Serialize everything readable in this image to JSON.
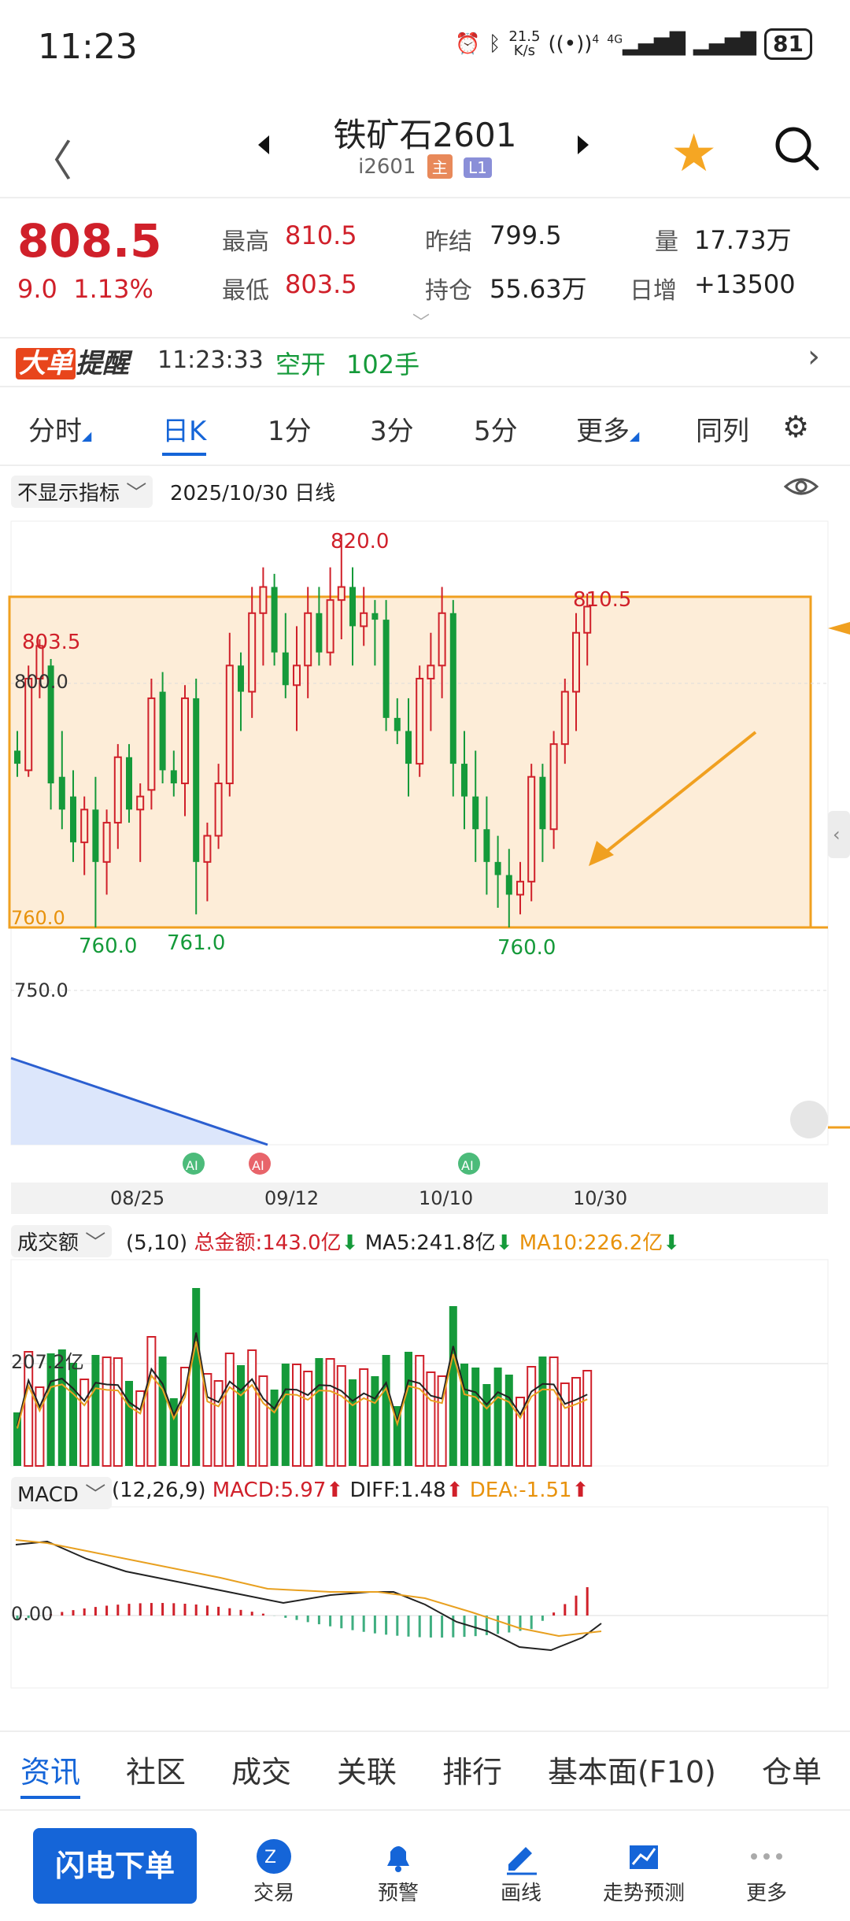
{
  "status": {
    "time": "11:23",
    "net_speed_top": "21.5",
    "net_speed_unit": "K/s",
    "sig1": "4",
    "net_type": "4G",
    "battery": "81"
  },
  "header": {
    "title": "铁矿石2601",
    "code": "i2601",
    "tag_main": "主",
    "tag_l1": "L1"
  },
  "quote": {
    "price": "808.5",
    "change": "9.0",
    "change_pct": "1.13%",
    "high_label": "最高",
    "high": "810.5",
    "low_label": "最低",
    "low": "803.5",
    "prev_label": "昨结",
    "prev": "799.5",
    "oi_label": "持仓",
    "oi": "55.63万",
    "vol_label": "量",
    "vol": "17.73万",
    "daily_label": "日增",
    "daily": "+13500"
  },
  "alert": {
    "logo1": "大单",
    "logo2": "提醒",
    "time": "11:23:33",
    "type": "空开",
    "qty": "102手"
  },
  "tabs": [
    "分时",
    "日K",
    "1分",
    "3分",
    "5分",
    "更多",
    "同列"
  ],
  "active_tab": "日K",
  "chart": {
    "indicator_select": "不显示指标",
    "date_label": "2025/10/30 日线",
    "price_labels": {
      "p820": "820.0",
      "p803": "803.5",
      "p800": "800.0",
      "p760": "760.0",
      "p810": "810.5",
      "low1": "760.0",
      "low2": "761.0",
      "low3": "760.0",
      "p750": "750.0"
    },
    "dates": [
      "08/25",
      "09/12",
      "10/10",
      "10/30"
    ],
    "ai_badges": [
      "AI",
      "AI",
      "AI"
    ],
    "box_color": "#F0A020",
    "up_color": "#D0202A",
    "down_color": "#159A3A"
  },
  "volume": {
    "select": "成交额",
    "params": "(5,10)",
    "total": "总金额:143.0亿",
    "ma5": "MA5:241.8亿",
    "ma10": "MA10:226.2亿",
    "axis": "207.2亿"
  },
  "macd": {
    "select": "MACD",
    "params": "(12,26,9)",
    "macd": "MACD:5.97",
    "diff": "DIFF:1.48",
    "dea": "DEA:-1.51",
    "axis": "0.00"
  },
  "bottom_tabs": [
    "资讯",
    "社区",
    "成交",
    "关联",
    "排行",
    "基本面(F10)",
    "仓单"
  ],
  "bottom_nav": {
    "flash": "闪电下单",
    "items": [
      "交易",
      "预警",
      "画线",
      "走势预测",
      "更多"
    ]
  },
  "chart_data": {
    "type": "candlestick",
    "title": "",
    "xlabel": "",
    "ylabel": "",
    "x_ticks": [
      "08/25",
      "09/12",
      "10/10",
      "10/30"
    ],
    "annotations": [
      "820.0",
      "803.5",
      "810.5",
      "760.0",
      "761.0",
      "760.0"
    ],
    "ohlc": [
      [
        787,
        790,
        783,
        785
      ],
      [
        784,
        800,
        783,
        798
      ],
      [
        798,
        804,
        795,
        803
      ],
      [
        800,
        801,
        778,
        782
      ],
      [
        783,
        790,
        775,
        778
      ],
      [
        780,
        784,
        770,
        773
      ],
      [
        773,
        780,
        768,
        778
      ],
      [
        778,
        783,
        760,
        770
      ],
      [
        770,
        778,
        765,
        776
      ],
      [
        776,
        788,
        772,
        786
      ],
      [
        786,
        788,
        776,
        778
      ],
      [
        778,
        782,
        770,
        780
      ],
      [
        781,
        798,
        778,
        795
      ],
      [
        796,
        799,
        782,
        784
      ],
      [
        784,
        787,
        780,
        782
      ],
      [
        782,
        797,
        777,
        795
      ],
      [
        795,
        798,
        762,
        770
      ],
      [
        770,
        776,
        764,
        774
      ],
      [
        774,
        785,
        772,
        782
      ],
      [
        782,
        805,
        780,
        800
      ],
      [
        800,
        802,
        790,
        796
      ],
      [
        796,
        812,
        792,
        808
      ],
      [
        808,
        815,
        800,
        812
      ],
      [
        812,
        814,
        800,
        802
      ],
      [
        802,
        808,
        795,
        797
      ],
      [
        797,
        806,
        790,
        800
      ],
      [
        800,
        812,
        795,
        808
      ],
      [
        808,
        812,
        800,
        802
      ],
      [
        802,
        815,
        800,
        810
      ],
      [
        810,
        820,
        804,
        812
      ],
      [
        812,
        815,
        800,
        806
      ],
      [
        806,
        812,
        803,
        808
      ],
      [
        808,
        810,
        800,
        807
      ],
      [
        807,
        810,
        790,
        792
      ],
      [
        792,
        795,
        788,
        790
      ],
      [
        790,
        795,
        780,
        785
      ],
      [
        785,
        800,
        783,
        798
      ],
      [
        798,
        805,
        790,
        800
      ],
      [
        800,
        812,
        795,
        808
      ],
      [
        808,
        810,
        780,
        785
      ],
      [
        785,
        790,
        775,
        780
      ],
      [
        780,
        787,
        770,
        775
      ],
      [
        775,
        780,
        765,
        770
      ],
      [
        770,
        774,
        763,
        768
      ],
      [
        768,
        772,
        760,
        765
      ],
      [
        765,
        770,
        762,
        767
      ],
      [
        767,
        785,
        764,
        783
      ],
      [
        783,
        785,
        770,
        775
      ],
      [
        775,
        790,
        772,
        788
      ],
      [
        788,
        798,
        785,
        796
      ],
      [
        796,
        808,
        790,
        805
      ],
      [
        805,
        811,
        800,
        809
      ]
    ]
  }
}
